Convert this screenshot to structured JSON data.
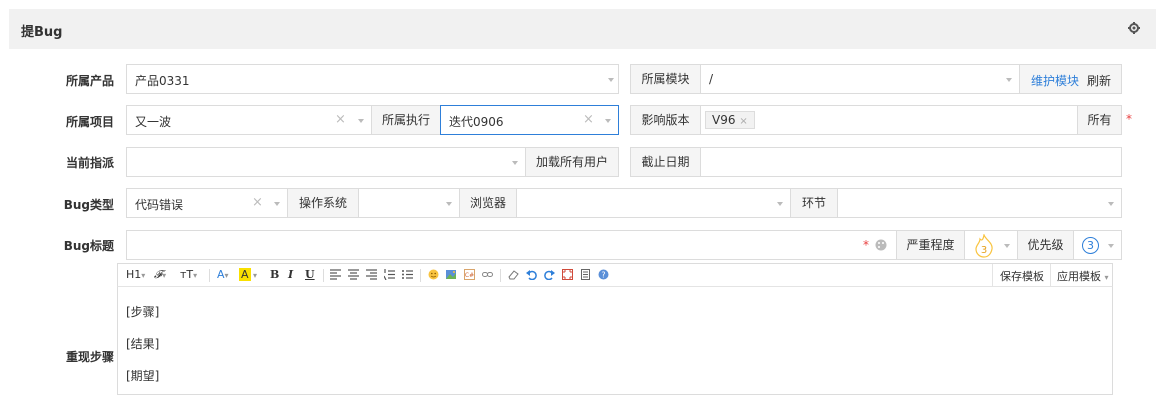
{
  "panel": {
    "title": "提Bug",
    "settings_icon": "gear-icon"
  },
  "row1": {
    "product_label": "所属产品",
    "product_value": "产品0331",
    "module_label": "所属模块",
    "module_value": "/",
    "maintain_link": "维护模块",
    "refresh_link": "刷新"
  },
  "row2": {
    "project_label": "所属项目",
    "project_value": "又一波",
    "execution_label": "所属执行",
    "execution_value": "迭代0906",
    "version_label": "影响版本",
    "version_tag": "V96",
    "all_label": "所有",
    "required_mark": "*"
  },
  "row3": {
    "assign_label": "当前指派",
    "assign_value": "",
    "load_users_button": "加载所有用户",
    "deadline_label": "截止日期",
    "deadline_value": ""
  },
  "row4": {
    "type_label": "Bug类型",
    "type_value": "代码错误",
    "os_label": "操作系统",
    "browser_label": "浏览器",
    "env_label": "环节"
  },
  "row5": {
    "title_label": "Bug标题",
    "title_value": "",
    "required_mark": "*",
    "severity_label": "严重程度",
    "severity_value": "3",
    "priority_label": "优先级",
    "priority_value": "3"
  },
  "row6": {
    "steps_label": "重现步骤",
    "toolbar": {
      "heading": "H1",
      "font": "𝓕",
      "size": "тT",
      "font_color": "A",
      "bg_color": "A",
      "bold": "B",
      "italic": "I",
      "underline": "U",
      "save_template": "保存模板",
      "apply_template": "应用模板"
    },
    "editor_lines": [
      "[步骤]",
      "[结果]",
      "[期望]"
    ]
  },
  "colors": {
    "accent": "#2e7fd9",
    "required": "#e93f3f",
    "focus": "#2e7fd9",
    "severity": "#f9c440"
  }
}
